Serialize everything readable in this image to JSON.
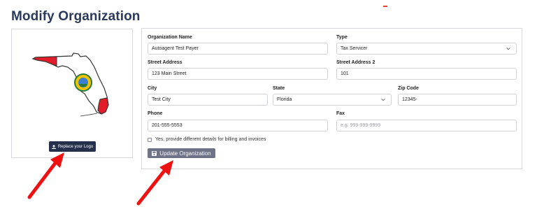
{
  "page": {
    "title": "Modify Organization"
  },
  "logo": {
    "replace_label": "Replace your Logo"
  },
  "form": {
    "org_name": {
      "label": "Organization Name",
      "value": "Autoagent Test Payer"
    },
    "type": {
      "label": "Type",
      "value": "Tax Servicer"
    },
    "street1": {
      "label": "Street Address",
      "value": "123 Main Street"
    },
    "street2": {
      "label": "Street Address 2",
      "value": "101"
    },
    "city": {
      "label": "City",
      "value": "Test City"
    },
    "state": {
      "label": "State",
      "value": "Florida"
    },
    "zip": {
      "label": "Zip Code",
      "value": "12345-"
    },
    "phone": {
      "label": "Phone",
      "value": "201-555-5553"
    },
    "fax": {
      "label": "Fax",
      "placeholder": "e.g. 999-999-9999"
    },
    "billing_checkbox_label": "Yes, provide different details for billing and invoices",
    "update_label": "Update Organization"
  },
  "colors": {
    "title": "#2a3a5c",
    "dark_button": "#25304d",
    "update_button": "#6d7287",
    "arrow": "#ee1111",
    "florida_red": "#e11d2a"
  },
  "icons": {
    "replace": "upload-icon",
    "update": "save-icon",
    "caret": "chevron-down-icon"
  }
}
